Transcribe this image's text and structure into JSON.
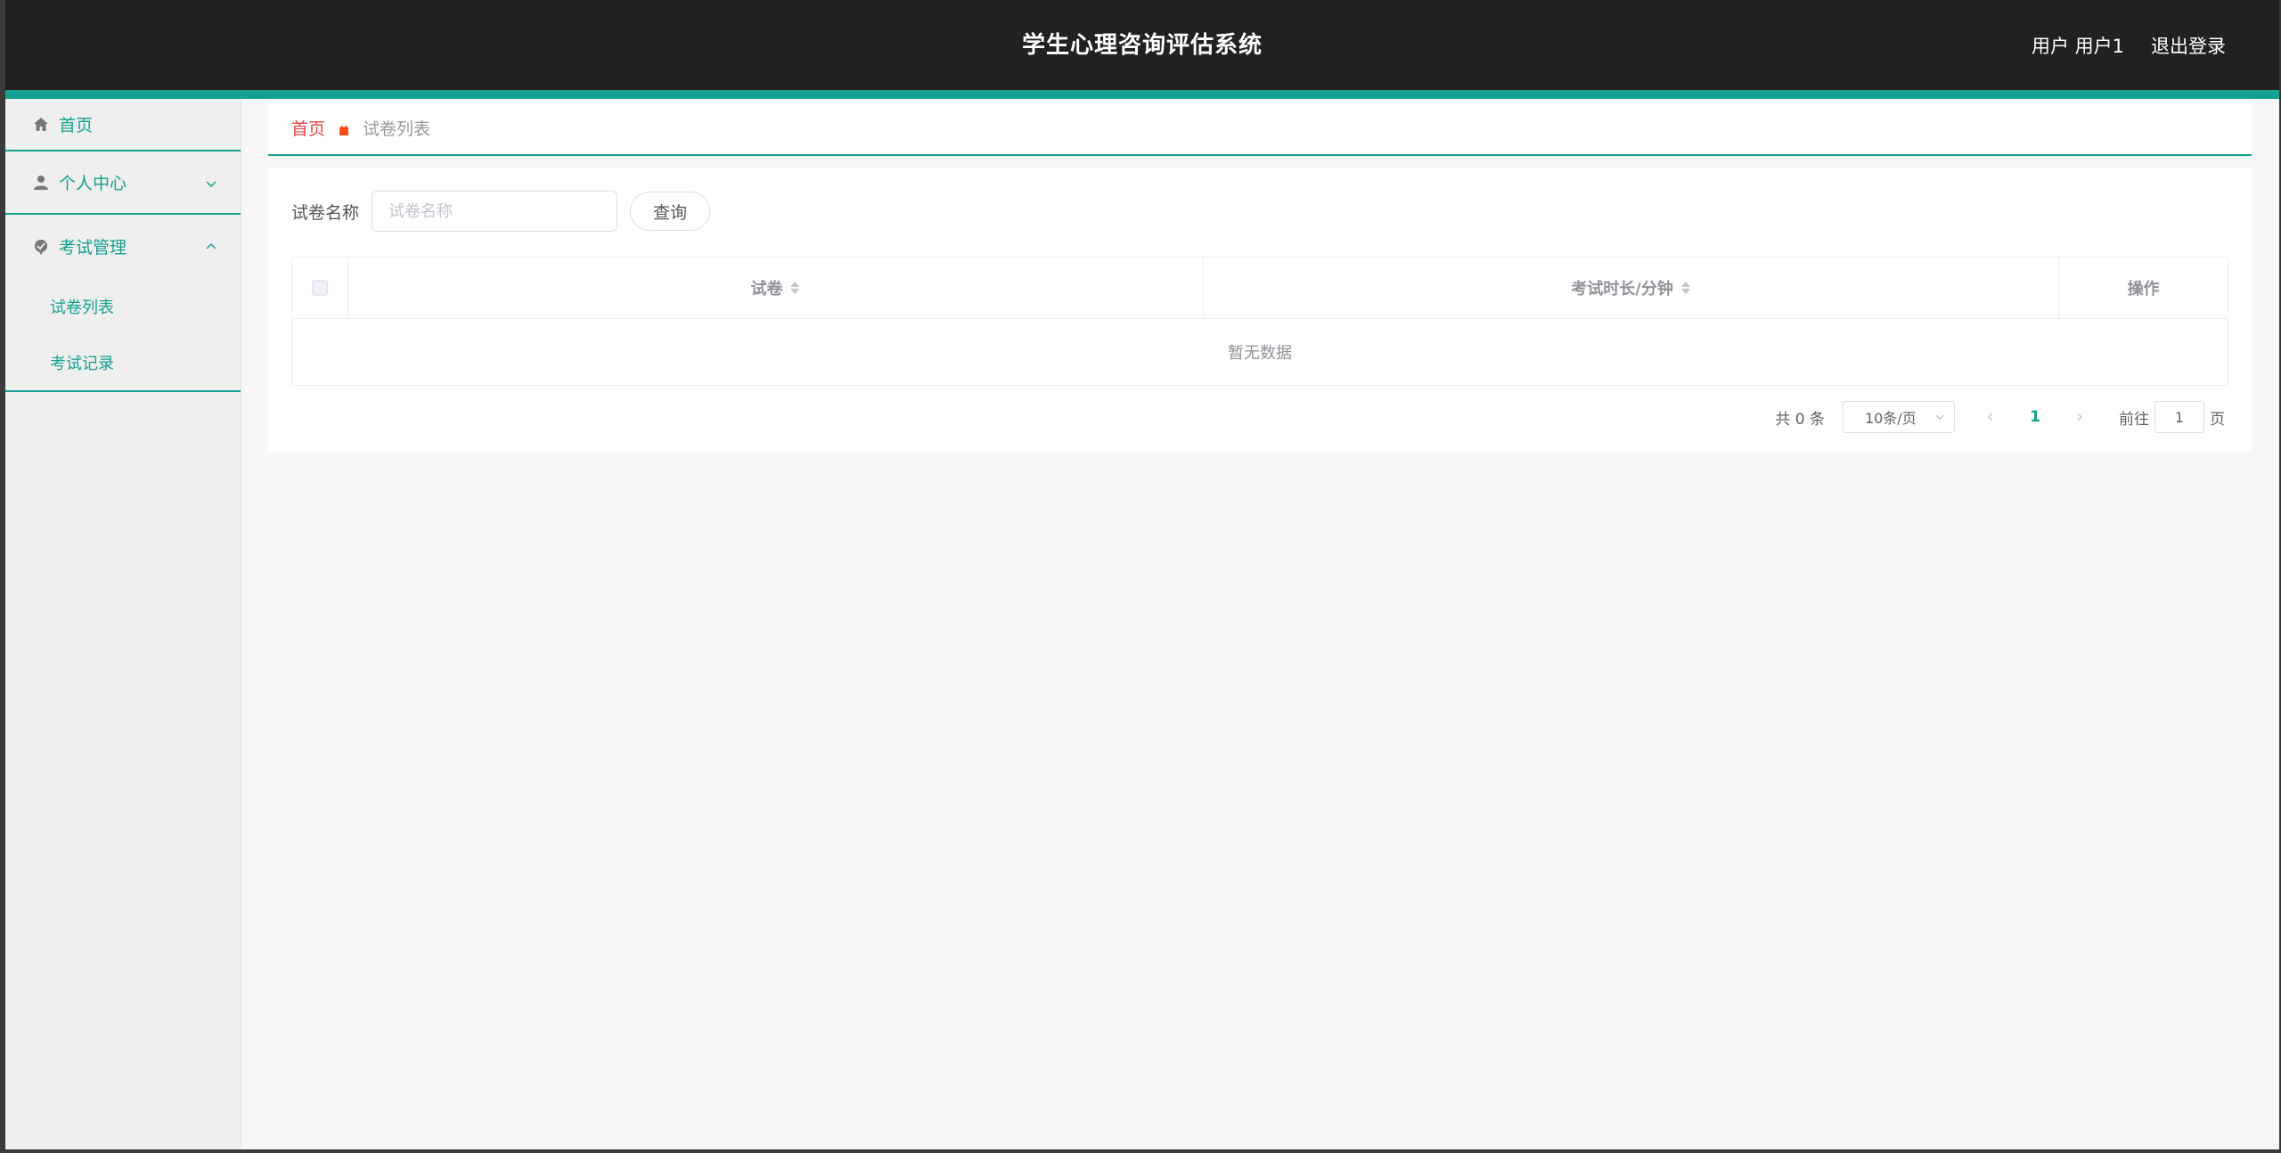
{
  "header": {
    "title": "学生心理咨询评估系统",
    "user_label": "用户 用户1",
    "logout_label": "退出登录"
  },
  "sidebar": {
    "items": [
      {
        "label": "首页",
        "icon": "home-icon"
      },
      {
        "label": "个人中心",
        "icon": "user-icon",
        "expanded": false
      },
      {
        "label": "考试管理",
        "icon": "exam-icon",
        "expanded": true,
        "children": [
          {
            "label": "试卷列表"
          },
          {
            "label": "考试记录"
          }
        ]
      }
    ]
  },
  "breadcrumb": {
    "home": "首页",
    "current": "试卷列表"
  },
  "search": {
    "label": "试卷名称",
    "placeholder": "试卷名称",
    "value": "",
    "button_label": "查询"
  },
  "table": {
    "columns": [
      "试卷",
      "考试时长/分钟",
      "操作"
    ],
    "rows": [],
    "empty_text": "暂无数据"
  },
  "pagination": {
    "total_text": "共 0 条",
    "page_size": "10条/页",
    "current_page": "1",
    "goto_label": "前往",
    "goto_value": "1",
    "page_suffix": "页"
  },
  "colors": {
    "accent": "#15a08f",
    "header_bg": "#212121",
    "breadcrumb_home": "#e8424a"
  }
}
